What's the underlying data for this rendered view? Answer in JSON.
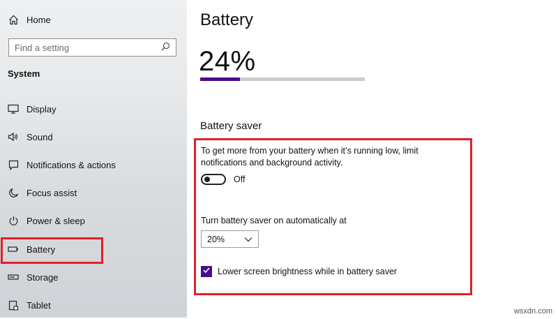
{
  "sidebar": {
    "home_label": "Home",
    "search_placeholder": "Find a setting",
    "section_label": "System",
    "items": [
      {
        "label": "Display",
        "icon": "monitor-icon"
      },
      {
        "label": "Sound",
        "icon": "speaker-icon"
      },
      {
        "label": "Notifications & actions",
        "icon": "notifications-icon"
      },
      {
        "label": "Focus assist",
        "icon": "moon-icon"
      },
      {
        "label": "Power & sleep",
        "icon": "power-icon"
      },
      {
        "label": "Battery",
        "icon": "battery-icon"
      },
      {
        "label": "Storage",
        "icon": "storage-icon"
      },
      {
        "label": "Tablet",
        "icon": "tablet-icon"
      }
    ]
  },
  "main": {
    "title": "Battery",
    "percent_text": "24%",
    "battery_level": 0.24,
    "saver_heading": "Battery saver",
    "saver_description": "To get more from your battery when it’s running low, limit notifications and background activity.",
    "toggle_state_label": "Off",
    "auto_label": "Turn battery saver on automatically at",
    "auto_value": "20%",
    "brightness_label": "Lower screen brightness while in battery saver",
    "brightness_checked": true
  },
  "colors": {
    "accent": "#4b0d8a",
    "highlight": "#e0202a"
  },
  "watermark": "wsxdn.com"
}
